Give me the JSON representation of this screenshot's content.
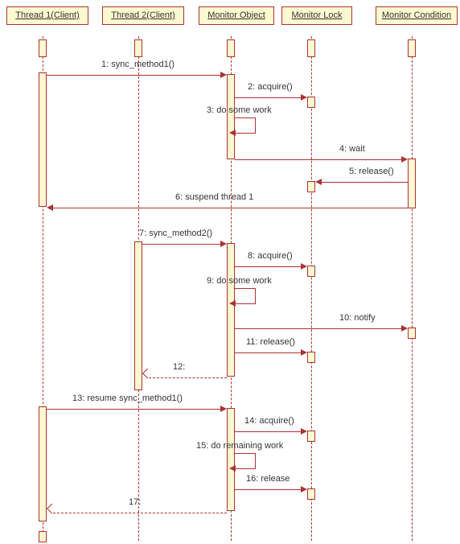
{
  "diagram_type": "uml-sequence-diagram",
  "lifelines": {
    "thread1": "Thread 1(Client)",
    "thread2": "Thread 2(Client)",
    "monitor_object": "Monitor Object",
    "monitor_lock": "Monitor Lock",
    "monitor_condition": "Monitor Condition"
  },
  "messages": {
    "m1": "1: sync_method1()",
    "m2": "2: acquire()",
    "m3": "3: do some work",
    "m4": "4: wait",
    "m5": "5: release()",
    "m6": "6: suspend thread 1",
    "m7": "7: sync_method2()",
    "m8": "8: acquire()",
    "m9": "9: do some work",
    "m10": "10: notify",
    "m11": "11: release()",
    "m12": "12:",
    "m13": "13: resume sync_method1()",
    "m14": "14: acquire()",
    "m15": "15: do remaining work",
    "m16": "16: release",
    "m17": "17:"
  },
  "chart_data": {
    "type": "sequence-diagram",
    "participants": [
      "Thread 1(Client)",
      "Thread 2(Client)",
      "Monitor Object",
      "Monitor Lock",
      "Monitor Condition"
    ],
    "interactions": [
      {
        "n": 1,
        "from": "Thread 1(Client)",
        "to": "Monitor Object",
        "label": "sync_method1()",
        "kind": "call"
      },
      {
        "n": 2,
        "from": "Monitor Object",
        "to": "Monitor Lock",
        "label": "acquire()",
        "kind": "call"
      },
      {
        "n": 3,
        "from": "Monitor Object",
        "to": "Monitor Object",
        "label": "do some work",
        "kind": "self"
      },
      {
        "n": 4,
        "from": "Monitor Object",
        "to": "Monitor Condition",
        "label": "wait",
        "kind": "call"
      },
      {
        "n": 5,
        "from": "Monitor Condition",
        "to": "Monitor Lock",
        "label": "release()",
        "kind": "call"
      },
      {
        "n": 6,
        "from": "Monitor Condition",
        "to": "Thread 1(Client)",
        "label": "suspend thread 1",
        "kind": "call"
      },
      {
        "n": 7,
        "from": "Thread 2(Client)",
        "to": "Monitor Object",
        "label": "sync_method2()",
        "kind": "call"
      },
      {
        "n": 8,
        "from": "Monitor Object",
        "to": "Monitor Lock",
        "label": "acquire()",
        "kind": "call"
      },
      {
        "n": 9,
        "from": "Monitor Object",
        "to": "Monitor Object",
        "label": "do some work",
        "kind": "self"
      },
      {
        "n": 10,
        "from": "Monitor Object",
        "to": "Monitor Condition",
        "label": "notify",
        "kind": "call"
      },
      {
        "n": 11,
        "from": "Monitor Object",
        "to": "Monitor Lock",
        "label": "release()",
        "kind": "call"
      },
      {
        "n": 12,
        "from": "Monitor Object",
        "to": "Thread 2(Client)",
        "label": "",
        "kind": "return"
      },
      {
        "n": 13,
        "from": "Thread 1(Client)",
        "to": "Monitor Object",
        "label": "resume sync_method1()",
        "kind": "call"
      },
      {
        "n": 14,
        "from": "Monitor Object",
        "to": "Monitor Lock",
        "label": "acquire()",
        "kind": "call"
      },
      {
        "n": 15,
        "from": "Monitor Object",
        "to": "Monitor Object",
        "label": "do remaining work",
        "kind": "self"
      },
      {
        "n": 16,
        "from": "Monitor Object",
        "to": "Monitor Lock",
        "label": "release",
        "kind": "call"
      },
      {
        "n": 17,
        "from": "Monitor Object",
        "to": "Thread 1(Client)",
        "label": "",
        "kind": "return"
      }
    ]
  }
}
